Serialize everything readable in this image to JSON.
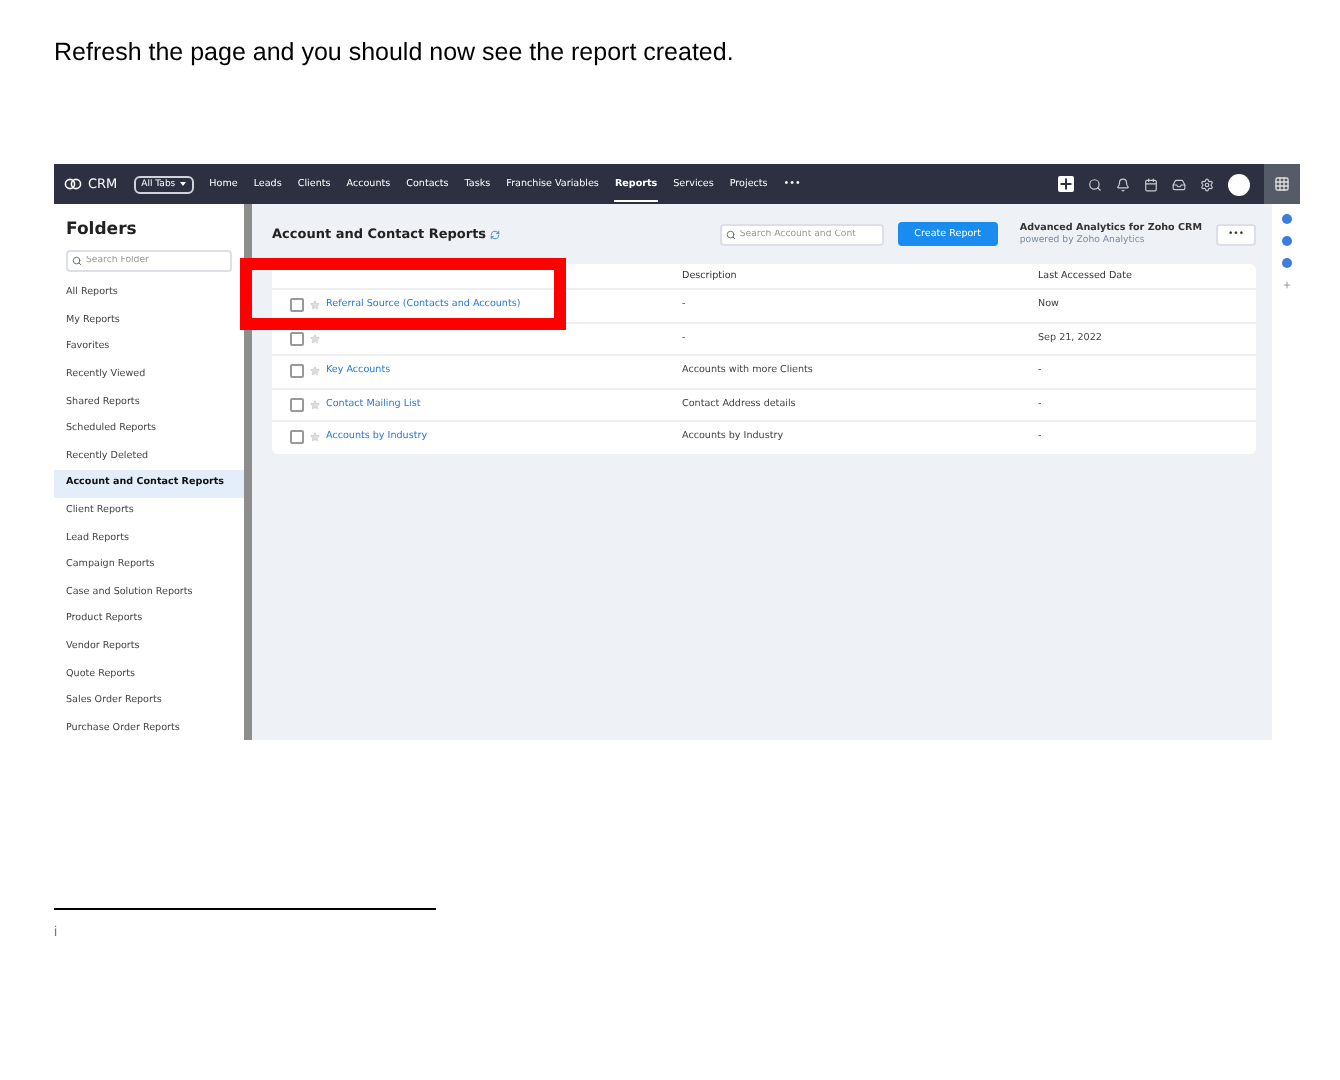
{
  "instruction": "Refresh the page and you should now see the report created.",
  "screenshot": {
    "topbar": {
      "logo": "CRM",
      "all_tabs": "All Tabs",
      "nav": [
        {
          "label": "Home",
          "selected": false
        },
        {
          "label": "Leads",
          "selected": false
        },
        {
          "label": "Clients",
          "selected": false
        },
        {
          "label": "Accounts",
          "selected": false
        },
        {
          "label": "Contacts",
          "selected": false
        },
        {
          "label": "Tasks",
          "selected": false
        },
        {
          "label": "Franchise Variables",
          "selected": false
        },
        {
          "label": "Reports",
          "selected": true
        },
        {
          "label": "Services",
          "selected": false
        },
        {
          "label": "Projects",
          "selected": false
        }
      ],
      "more": "•••"
    },
    "sidebar": {
      "title": "Folders",
      "search": {
        "placeholder": "Search Folder"
      },
      "items": [
        {
          "label": "All Reports",
          "selected": false
        },
        {
          "label": "My Reports",
          "selected": false
        },
        {
          "label": "Favorites",
          "selected": false
        },
        {
          "label": "Recently Viewed",
          "selected": false
        },
        {
          "label": "Shared Reports",
          "selected": false
        },
        {
          "label": "Scheduled Reports",
          "selected": false
        },
        {
          "label": "Recently Deleted",
          "selected": false
        },
        {
          "label": "Account and Contact Reports",
          "selected": true
        },
        {
          "label": "Client Reports",
          "selected": false
        },
        {
          "label": "Lead Reports",
          "selected": false
        },
        {
          "label": "Campaign Reports",
          "selected": false
        },
        {
          "label": "Case and Solution Reports",
          "selected": false
        },
        {
          "label": "Product Reports",
          "selected": false
        },
        {
          "label": "Vendor Reports",
          "selected": false
        },
        {
          "label": "Quote Reports",
          "selected": false
        },
        {
          "label": "Sales Order Reports",
          "selected": false
        },
        {
          "label": "Purchase Order Reports",
          "selected": false
        }
      ]
    },
    "main": {
      "title": "Account and Contact Reports",
      "search": {
        "placeholder": "Search Account and Cont"
      },
      "create_button": "Create Report",
      "analytics": {
        "title": "Advanced Analytics for Zoho CRM",
        "subtitle": "powered by Zoho Analytics"
      },
      "more_button": "•••",
      "table": {
        "columns": [
          "Description",
          "Last Accessed Date"
        ],
        "rows": [
          {
            "name": "Referral Source (Contacts and Accounts)",
            "checked": false,
            "description": "-",
            "last_accessed": "Now"
          },
          {
            "checked": false,
            "description": "-",
            "last_accessed": "Sep 21, 2022"
          },
          {
            "name": "Key Accounts",
            "checked": false,
            "description": "Accounts with more Clients",
            "last_accessed": "-"
          },
          {
            "name": "Contact Mailing List",
            "checked": false,
            "description": "Contact Address details",
            "last_accessed": "-"
          },
          {
            "name": "Accounts by Industry",
            "checked": false,
            "description": "Accounts by Industry",
            "last_accessed": "-"
          }
        ]
      }
    }
  },
  "footnote": {
    "marker": "i"
  }
}
